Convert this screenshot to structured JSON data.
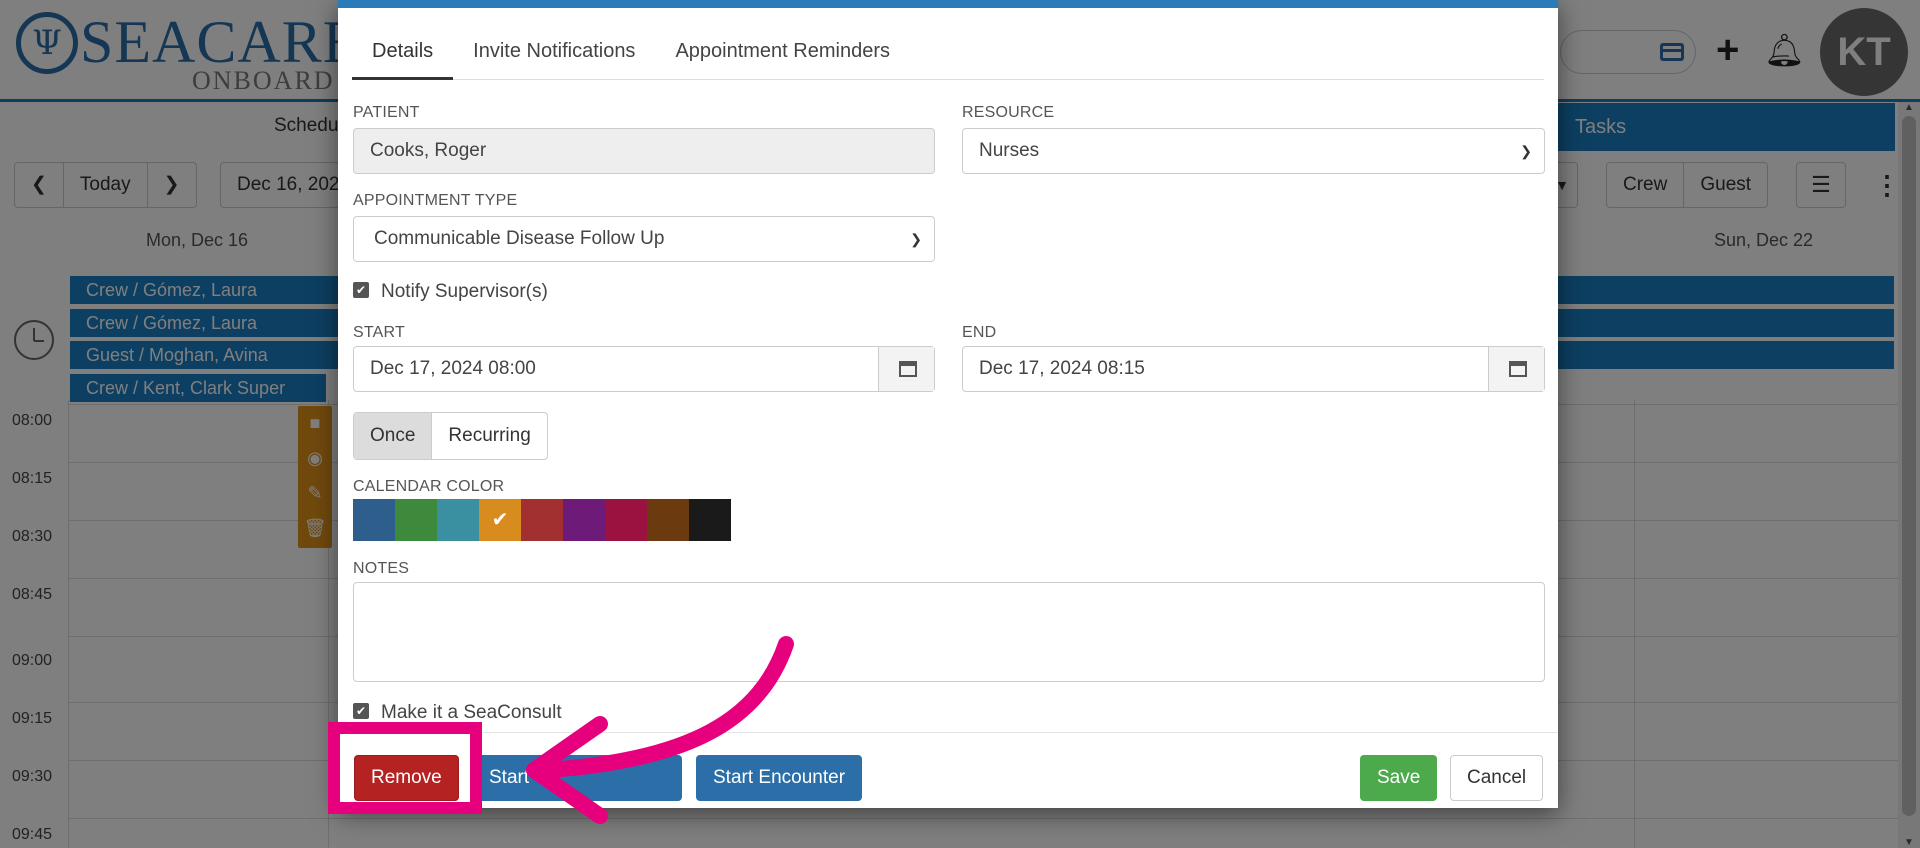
{
  "header": {
    "logo_main": "SEACARE",
    "logo_sub": "ONBOARD",
    "avatar_initials": "KT"
  },
  "nav": {
    "schedule_label": "Schedu",
    "tasks_label": "Tasks"
  },
  "toolbar": {
    "today_label": "Today",
    "date_value": "Dec 16, 202",
    "crew_label": "Crew",
    "guest_label": "Guest"
  },
  "calendar": {
    "day_headers": [
      "Mon, Dec 16",
      "Sun, Dec 22"
    ],
    "allday_events": [
      "Crew / Gómez, Laura",
      "Crew / Gómez, Laura",
      "Guest / Moghan, Avina",
      "Crew / Kent, Clark Super"
    ],
    "time_slots": [
      "08:00",
      "08:15",
      "08:30",
      "08:45",
      "09:00",
      "09:15",
      "09:30",
      "09:45"
    ]
  },
  "modal": {
    "tabs": [
      "Details",
      "Invite Notifications",
      "Appointment Reminders"
    ],
    "patient_label": "PATIENT",
    "patient_value": "Cooks, Roger",
    "resource_label": "RESOURCE",
    "resource_value": "Nurses",
    "appt_type_label": "APPOINTMENT TYPE",
    "appt_type_value": "Communicable Disease Follow Up",
    "notify_label": "Notify Supervisor(s)",
    "start_label": "START",
    "start_value": "Dec 17, 2024 08:00",
    "end_label": "END",
    "end_value": "Dec 17, 2024 08:15",
    "once_label": "Once",
    "recurring_label": "Recurring",
    "color_label": "CALENDAR COLOR",
    "colors": [
      "#2d5e8c",
      "#3d8a3d",
      "#3a8fa0",
      "#d98c1e",
      "#a33030",
      "#6d1a78",
      "#9b1240",
      "#6b3a0e",
      "#1a1a1a"
    ],
    "selected_color_index": 3,
    "notes_label": "NOTES",
    "notes_value": "",
    "seaconsult_label": "Make it a SeaConsult",
    "remove_label": "Remove",
    "start_btn_label": "Start",
    "start_encounter_label": "Start Encounter",
    "save_label": "Save",
    "cancel_label": "Cancel"
  },
  "annotation": {
    "highlight_color": "#e6007e"
  }
}
